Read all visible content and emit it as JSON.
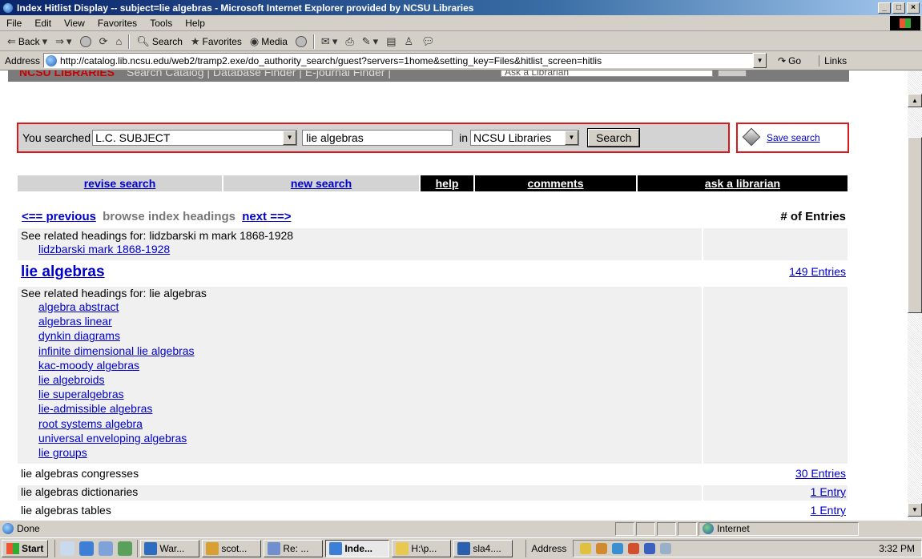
{
  "window": {
    "title": "Index Hitlist Display -- subject=lie algebras - Microsoft Internet Explorer provided by NCSU Libraries",
    "controls": [
      "_",
      "□",
      "×"
    ]
  },
  "menu": [
    "File",
    "Edit",
    "View",
    "Favorites",
    "Tools",
    "Help"
  ],
  "toolbar": {
    "back": "Back",
    "search": "Search",
    "favorites": "Favorites",
    "media": "Media"
  },
  "address": {
    "label": "Address",
    "url": "http://catalog.lib.ncsu.edu/web2/tramp2.exe/do_authority_search/guest?servers=1home&setting_key=Files&hitlist_screen=hitlis",
    "go": "Go",
    "links": "Links"
  },
  "site_header": {
    "brand": "NCSU LIBRARIES",
    "nav": "Search Catalog  |  Database Finder  |  E-journal Finder  |",
    "ask_placeholder": "Ask a Librarian"
  },
  "search": {
    "you_searched": "You searched",
    "field": "L.C. SUBJECT",
    "query": "lie algebras",
    "in": "in",
    "library": "NCSU Libraries",
    "button": "Search",
    "save": "Save search"
  },
  "nav": {
    "revise": "revise search",
    "new": "new search",
    "help": "help",
    "comments": "comments",
    "ask": "ask a librarian"
  },
  "browse": {
    "previous": "<== previous",
    "middle": "browse index headings",
    "next": "next ==>",
    "entries_header": "# of Entries"
  },
  "results": {
    "related1_label": "See related headings for: lidzbarski m mark 1868-1928",
    "related1_link": "lidzbarski mark 1868-1928",
    "heading": "lie algebras",
    "heading_count": "149 Entries",
    "related2_label": "See related headings for: lie algebras",
    "related2_links": [
      "algebra abstract",
      "algebras linear",
      "dynkin diagrams",
      "infinite dimensional lie algebras",
      "kac-moody algebras",
      "lie algebroids",
      "lie superalgebras",
      "lie-admissible algebras",
      "root systems algebra",
      "universal enveloping algebras",
      "lie groups"
    ],
    "rows": [
      {
        "label": "lie algebras congresses",
        "count": "30 Entries"
      },
      {
        "label": "lie algebras dictionaries",
        "count": "1 Entry"
      },
      {
        "label": "lie algebras tables",
        "count": "1 Entry"
      }
    ]
  },
  "status": {
    "text": "Done",
    "zone": "Internet"
  },
  "taskbar": {
    "start": "Start",
    "tasks": [
      "War...",
      "scot...",
      "Re: ...",
      "Inde...",
      "H:\\p...",
      "sla4...."
    ],
    "address": "Address",
    "clock": "3:32 PM"
  }
}
